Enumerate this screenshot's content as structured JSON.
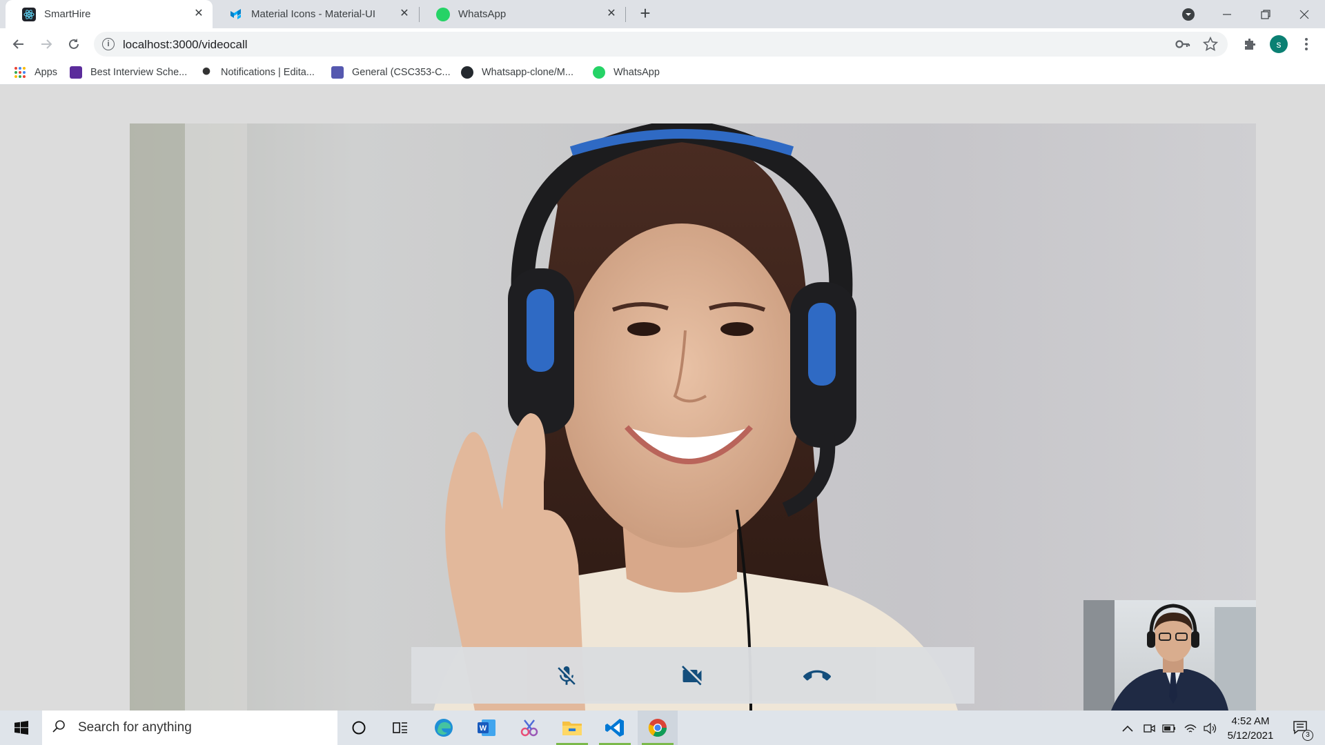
{
  "browser": {
    "tabs": [
      {
        "title": "SmartHire",
        "active": true
      },
      {
        "title": "Material Icons - Material-UI",
        "active": false
      },
      {
        "title": "WhatsApp",
        "active": false
      }
    ],
    "url": "localhost:3000/videocall",
    "profile_initial": "s",
    "bookmarks": [
      {
        "label": "Apps"
      },
      {
        "label": "Best Interview Sche..."
      },
      {
        "label": "Notifications | Edita..."
      },
      {
        "label": "General (CSC353-C..."
      },
      {
        "label": "Whatsapp-clone/M..."
      },
      {
        "label": "WhatsApp"
      }
    ]
  },
  "videocall": {
    "controls": [
      {
        "name": "mic-off",
        "icon": "mic-off-icon"
      },
      {
        "name": "videocam-off",
        "icon": "videocam-off-icon"
      },
      {
        "name": "end-call",
        "icon": "call-end-icon"
      }
    ],
    "accent": "#0d4a7a"
  },
  "taskbar": {
    "search_placeholder": "Search for anything",
    "time": "4:52 AM",
    "date": "5/12/2021",
    "notification_count": "3"
  }
}
